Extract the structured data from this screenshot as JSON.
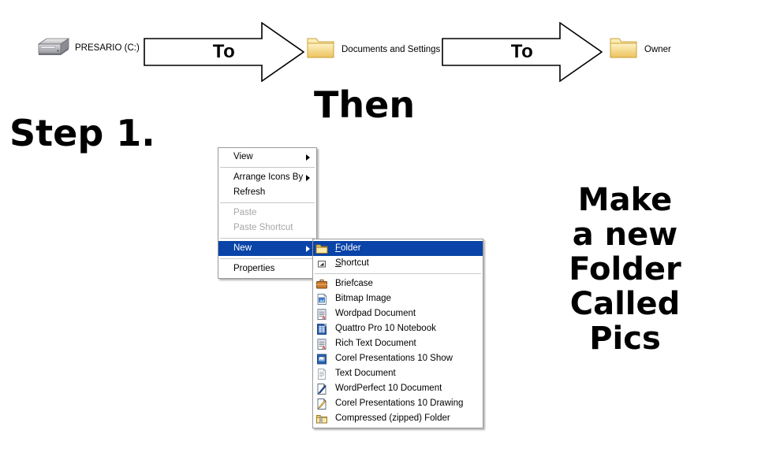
{
  "flow": {
    "steps": [
      {
        "icon": "hard-drive-icon",
        "label": "PRESARIO (C:)"
      },
      {
        "icon": "folder-icon",
        "label": "Documents and Settings"
      },
      {
        "icon": "folder-icon",
        "label": "Owner"
      }
    ],
    "arrows": [
      {
        "label": "To"
      },
      {
        "label": "To"
      }
    ]
  },
  "headings": {
    "step1": "Step 1.",
    "then": "Then",
    "instruction_lines": [
      "Make",
      "a new",
      "Folder",
      "Called",
      "Pics"
    ]
  },
  "context_menu": {
    "items": [
      {
        "label": "View",
        "submenu": true,
        "disabled": false,
        "selected": false,
        "separator_after": true
      },
      {
        "label": "Arrange Icons By",
        "submenu": true,
        "disabled": false,
        "selected": false,
        "separator_after": false
      },
      {
        "label": "Refresh",
        "submenu": false,
        "disabled": false,
        "selected": false,
        "separator_after": true
      },
      {
        "label": "Paste",
        "submenu": false,
        "disabled": true,
        "selected": false,
        "separator_after": false
      },
      {
        "label": "Paste Shortcut",
        "submenu": false,
        "disabled": true,
        "selected": false,
        "separator_after": true
      },
      {
        "label": "New",
        "submenu": true,
        "disabled": false,
        "selected": true,
        "separator_after": true
      },
      {
        "label": "Properties",
        "submenu": false,
        "disabled": false,
        "selected": false,
        "separator_after": false
      }
    ]
  },
  "new_submenu": {
    "items": [
      {
        "label": "Folder",
        "accel": "F",
        "icon": "folder-icon",
        "selected": true,
        "separator_after": false
      },
      {
        "label": "Shortcut",
        "accel": "S",
        "icon": "shortcut-icon",
        "selected": false,
        "separator_after": true
      },
      {
        "label": "Briefcase",
        "accel": "",
        "icon": "briefcase-icon",
        "selected": false,
        "separator_after": false
      },
      {
        "label": "Bitmap Image",
        "accel": "",
        "icon": "bitmap-image-icon",
        "selected": false,
        "separator_after": false
      },
      {
        "label": "Wordpad Document",
        "accel": "",
        "icon": "wordpad-document-icon",
        "selected": false,
        "separator_after": false
      },
      {
        "label": "Quattro Pro 10 Notebook",
        "accel": "",
        "icon": "quattro-pro-icon",
        "selected": false,
        "separator_after": false
      },
      {
        "label": "Rich Text Document",
        "accel": "",
        "icon": "rich-text-icon",
        "selected": false,
        "separator_after": false
      },
      {
        "label": "Corel Presentations 10 Show",
        "accel": "",
        "icon": "corel-show-icon",
        "selected": false,
        "separator_after": false
      },
      {
        "label": "Text Document",
        "accel": "",
        "icon": "text-document-icon",
        "selected": false,
        "separator_after": false
      },
      {
        "label": "WordPerfect 10 Document",
        "accel": "",
        "icon": "wordperfect-icon",
        "selected": false,
        "separator_after": false
      },
      {
        "label": "Corel Presentations 10 Drawing",
        "accel": "",
        "icon": "corel-drawing-icon",
        "selected": false,
        "separator_after": false
      },
      {
        "label": "Compressed (zipped) Folder",
        "accel": "",
        "icon": "compressed-folder-icon",
        "selected": false,
        "separator_after": false
      }
    ]
  },
  "colors": {
    "menu_highlight": "#0a44a8",
    "menu_border": "#9a9a9a",
    "folder_yellow": "#fdd87f",
    "disabled_text": "#a6a6a6"
  }
}
